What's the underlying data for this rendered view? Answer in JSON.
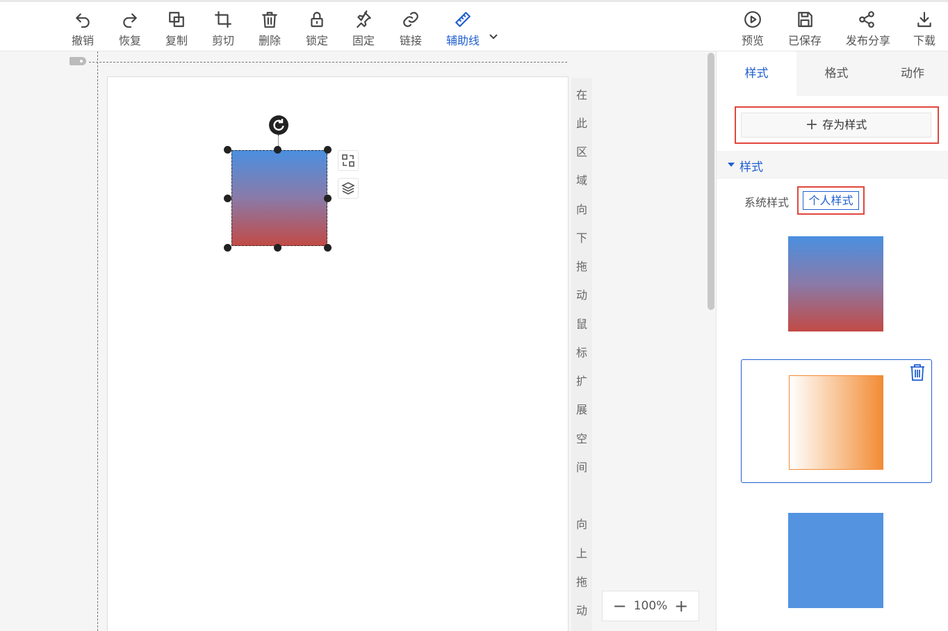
{
  "toolbar": {
    "undo": "撤销",
    "redo": "恢复",
    "copy": "复制",
    "cut": "剪切",
    "delete": "删除",
    "lock": "锁定",
    "pin": "固定",
    "link": "链接",
    "guides": "辅助线",
    "preview": "预览",
    "saved": "已保存",
    "publish": "发布分享",
    "download": "下载"
  },
  "canvas": {
    "side_hint_top": [
      "在",
      "此",
      "区",
      "域",
      "向",
      "下",
      "拖",
      "动",
      "鼠",
      "标",
      "扩",
      "展",
      "空",
      "间"
    ],
    "side_hint_bottom": [
      "向",
      "上",
      "拖",
      "动"
    ],
    "zoom_value": "100%",
    "zoom_minus": "−",
    "zoom_plus": "+",
    "shape_gradient": [
      "#4a8fe0",
      "#c24a45"
    ]
  },
  "panel": {
    "tabs": [
      "样式",
      "格式",
      "动作"
    ],
    "active_tab": "样式",
    "save_style_label": "存为样式",
    "save_style_icon": "+",
    "section_title": "样式",
    "sub_tabs": {
      "system": "系统样式",
      "personal": "个人样式"
    },
    "styles": [
      {
        "name": "blue-red-gradient",
        "colors": [
          "#4a8fe0",
          "#c24a45"
        ]
      },
      {
        "name": "white-orange-gradient",
        "colors": [
          "#ffffff",
          "#f28c35"
        ],
        "selected": true
      },
      {
        "name": "solid-blue",
        "colors": [
          "#5393e0"
        ]
      }
    ]
  },
  "colors": {
    "accent": "#1f5fcf",
    "highlight_border": "#e0473d"
  }
}
